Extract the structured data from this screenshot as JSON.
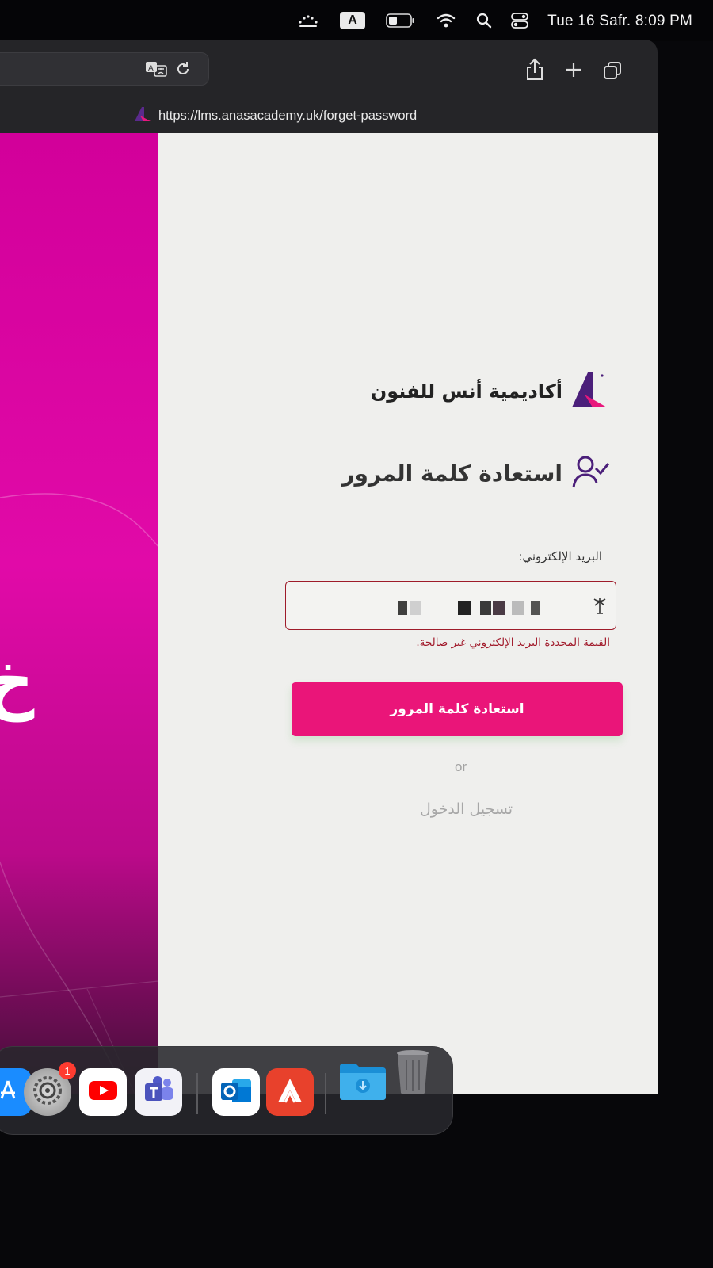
{
  "menubar": {
    "clock": "Tue 16 Safr.  8:09 PM",
    "input_source_letter": "A",
    "icons": [
      "dots-icon",
      "input-source-icon",
      "battery-icon",
      "wifi-icon",
      "search-icon",
      "control-center-icon"
    ]
  },
  "browser": {
    "url": "https://lms.anasacademy.uk/forget-password"
  },
  "hero": {
    "glyph": "خ"
  },
  "form": {
    "brand_name": "أكاديمية أنس للفنون",
    "heading": "استعادة كلمة المرور",
    "email_label": "البريد الإلكتروني:",
    "email_value": "",
    "error_message": "القيمة المحددة البريد الإلكتروني غير صالحة.",
    "submit_label": "استعادة كلمة المرور",
    "or_text": "or",
    "login_link": "تسجيل الدخول"
  },
  "dock": {
    "apps": [
      "App Store",
      "System Settings",
      "YouTube",
      "Microsoft Teams",
      "Microsoft Outlook",
      "Anas Academy",
      "Downloads",
      "Trash"
    ],
    "settings_badge": "1"
  },
  "colors": {
    "accent_pink": "#ea1579",
    "hero_magenta": "#d2009a",
    "brand_purple": "#4b1f7a",
    "error_red": "#a11a2b"
  }
}
